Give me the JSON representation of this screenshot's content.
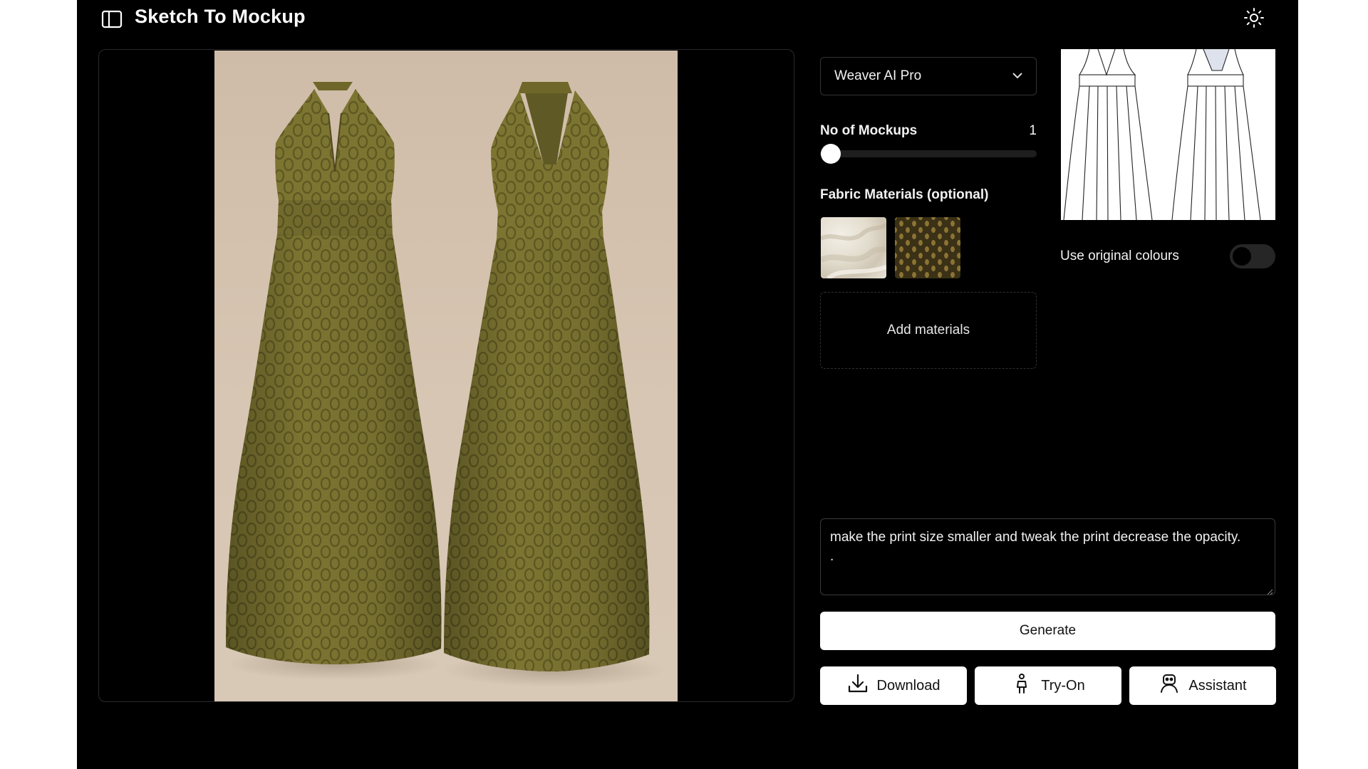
{
  "app": {
    "title": "Sketch To Mockup"
  },
  "icons": {
    "sidebar_toggle": "sidebar-panel-icon",
    "theme_toggle": "sun-icon",
    "select_chevron": "chevron-down-icon",
    "download": "download-icon",
    "tryon": "person-icon",
    "assistant": "robot-icon"
  },
  "model_select": {
    "selected": "Weaver AI Pro"
  },
  "mockups": {
    "label": "No of Mockups",
    "value": "1"
  },
  "fabric": {
    "label": "Fabric Materials (optional)",
    "swatches": [
      "cream-silk-fabric",
      "olive-leopard-print-fabric"
    ],
    "add_label": "Add materials"
  },
  "original_colours": {
    "label": "Use original colours",
    "enabled": false
  },
  "prompt": {
    "value": "make the print size smaller and tweak the print decrease the opacity.\n."
  },
  "buttons": {
    "generate": "Generate",
    "download": "Download",
    "tryon": "Try-On",
    "assistant": "Assistant"
  },
  "colors": {
    "background": "#000000",
    "dress": "#7a7230",
    "backdrop": "#d3c1ad",
    "button_bg": "#ffffff"
  }
}
